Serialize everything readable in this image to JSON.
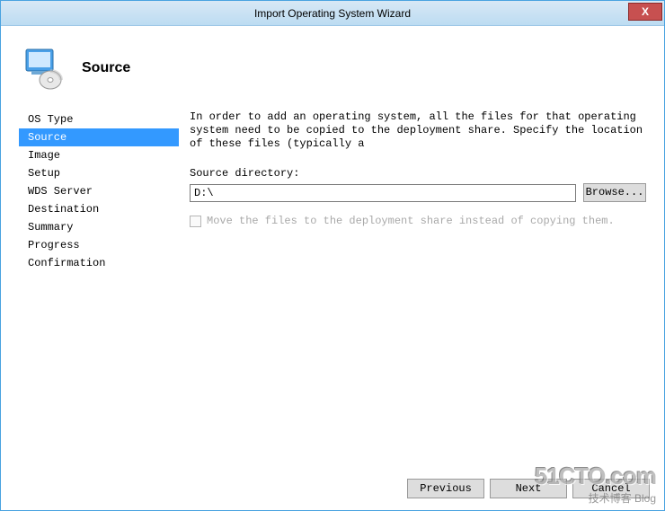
{
  "window": {
    "title": "Import Operating System Wizard",
    "close_glyph": "X"
  },
  "header": {
    "title": "Source"
  },
  "sidebar": {
    "items": [
      {
        "label": "OS Type"
      },
      {
        "label": "Source"
      },
      {
        "label": "Image"
      },
      {
        "label": "Setup"
      },
      {
        "label": "WDS Server"
      },
      {
        "label": "Destination"
      },
      {
        "label": "Summary"
      },
      {
        "label": "Progress"
      },
      {
        "label": "Confirmation"
      }
    ],
    "selected_index": 1
  },
  "main": {
    "instructions": "In order to add an operating system, all the files for that operating system need to be copied to the deployment share.  Specify the location of these files (typically a",
    "source_label": "Source directory:",
    "source_value": "D:\\",
    "browse_label": "Browse...",
    "move_checkbox_label": "Move the files to the deployment share instead of copying them."
  },
  "buttons": {
    "previous": "Previous",
    "next": "Next",
    "cancel": "Cancel"
  },
  "watermark": {
    "big": "51CTO.com",
    "small": "技术博客 Blog"
  }
}
